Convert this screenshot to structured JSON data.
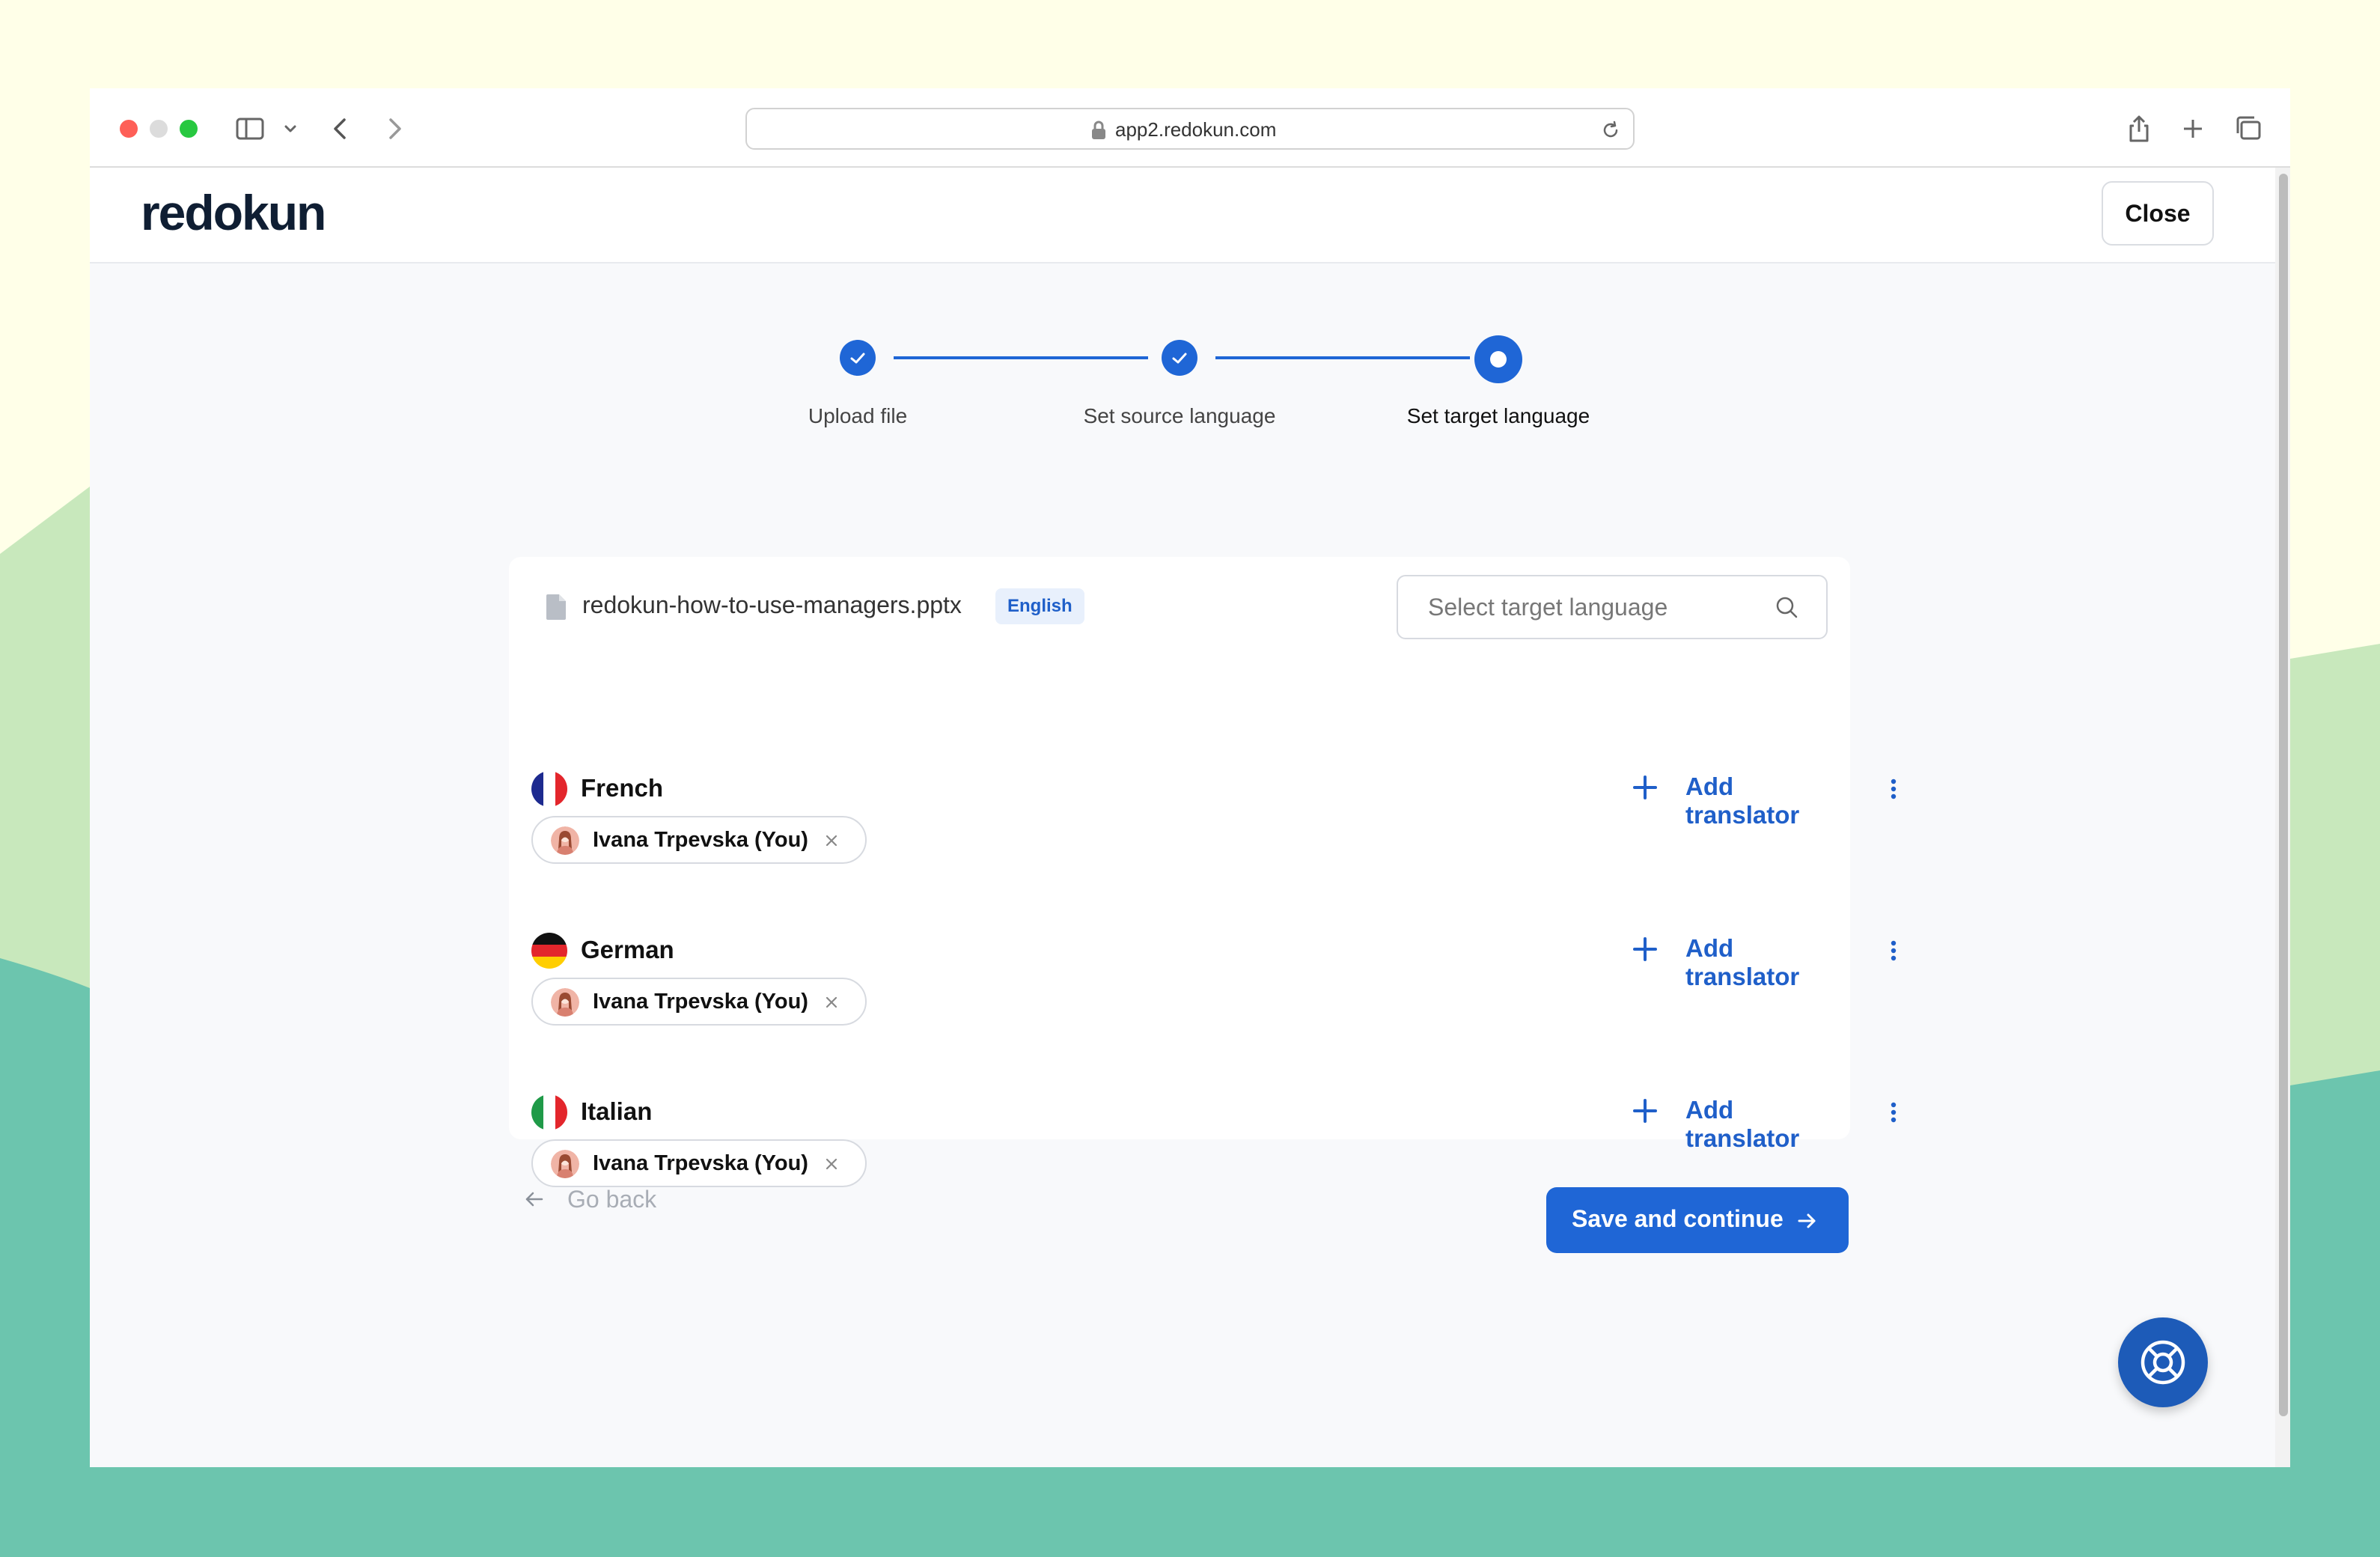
{
  "browser": {
    "url": "app2.redokun.com",
    "icons": [
      "sidebar-icon",
      "chevron-down-icon",
      "back-icon",
      "forward-icon",
      "lock-icon",
      "reload-icon",
      "share-icon",
      "new-tab-icon",
      "tabs-overview-icon"
    ]
  },
  "header": {
    "logo": "redokun",
    "close_label": "Close"
  },
  "stepper": {
    "steps": [
      {
        "label": "Upload file",
        "state": "done"
      },
      {
        "label": "Set source language",
        "state": "done"
      },
      {
        "label": "Set target language",
        "state": "current"
      }
    ]
  },
  "file": {
    "name": "redokun-how-to-use-managers.pptx",
    "source_language": "English"
  },
  "search": {
    "placeholder": "Select target language"
  },
  "languages": [
    {
      "name": "French",
      "add_label": "Add translator",
      "translator": "Ivana Trpevska (You)"
    },
    {
      "name": "German",
      "add_label": "Add translator",
      "translator": "Ivana Trpevska (You)"
    },
    {
      "name": "Italian",
      "add_label": "Add translator",
      "translator": "Ivana Trpevska (You)"
    }
  ],
  "actions": {
    "back_label": "Go back",
    "save_label": "Save and continue"
  },
  "colors": {
    "primary": "#1f66d6",
    "link": "#1f5fc9",
    "help_button": "#1d5bb8"
  }
}
